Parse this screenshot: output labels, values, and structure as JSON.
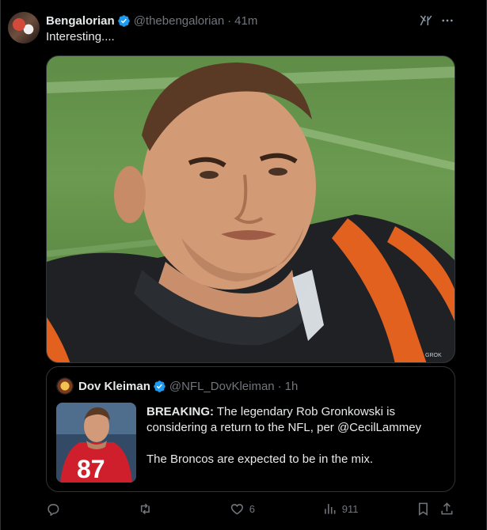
{
  "post": {
    "author_name": "Bengalorian",
    "handle": "@thebengalorian",
    "separator": "·",
    "time": "41m",
    "text": "Interesting....",
    "media_watermark": "GROK"
  },
  "quote": {
    "author_name": "Dov Kleiman",
    "handle": "@NFL_DovKleiman",
    "separator": "·",
    "time": "1h",
    "breaking_label": "BREAKING:",
    "line1_rest": " The legendary Rob Gronkowski is considering a return to the NFL, per @CecilLammey",
    "line2": "The Broncos are expected to be in the mix.",
    "jersey_number": "87"
  },
  "actions": {
    "replies": "",
    "reposts": "",
    "likes": "6",
    "views": "911"
  },
  "colors": {
    "background": "#000000",
    "text": "#e7e9ea",
    "muted": "#71767b",
    "border": "#2f3336",
    "verified": "#1d9bf0"
  },
  "icons": [
    "verified-icon",
    "grok-icon",
    "more-icon",
    "reply-icon",
    "repost-icon",
    "like-icon",
    "views-icon",
    "bookmark-icon",
    "share-icon"
  ]
}
